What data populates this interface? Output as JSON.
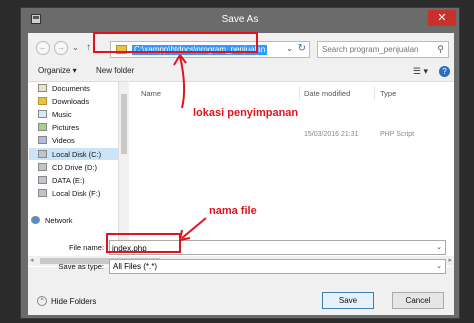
{
  "window": {
    "title": "Save As",
    "close_label": "✕"
  },
  "navigation": {
    "back": "←",
    "forward": "→",
    "recent": "⌄",
    "up": "↑",
    "address": "C:\\xampp\\htdocs\\program_penjualan",
    "address_dropdown": "⌄",
    "refresh": "↻",
    "search_placeholder": "Search program_penjualan",
    "search_icon": "⚲"
  },
  "toolbar": {
    "organize_label": "Organize ▾",
    "new_folder_label": "New folder",
    "view_icon": "☰ ▾",
    "help_icon": "?"
  },
  "sidebar": {
    "items": [
      {
        "label": "Documents",
        "icon": "documents-icon"
      },
      {
        "label": "Downloads",
        "icon": "downloads-icon"
      },
      {
        "label": "Music",
        "icon": "music-icon"
      },
      {
        "label": "Pictures",
        "icon": "pictures-icon"
      },
      {
        "label": "Videos",
        "icon": "videos-icon"
      },
      {
        "label": "Local Disk (C:)",
        "icon": "disk-icon",
        "selected": true
      },
      {
        "label": "CD Drive (D:)",
        "icon": "cd-drive-icon"
      },
      {
        "label": "DATA (E:)",
        "icon": "disk-icon"
      },
      {
        "label": "Local Disk (F:)",
        "icon": "disk-icon"
      },
      {
        "label": "Network",
        "icon": "network-icon"
      }
    ]
  },
  "file_list": {
    "columns": [
      "Name",
      "Date modified",
      "Type"
    ],
    "rows": [
      {
        "name": "",
        "date": "15/03/2016 21:31",
        "type": "PHP Script"
      }
    ]
  },
  "form": {
    "filename_label": "File name:",
    "filename_value": "index.php",
    "savetype_label": "Save as type:",
    "savetype_value": "All Files (*.*)",
    "dropdown_arrow": "⌄"
  },
  "footer": {
    "hide_folders_label": "Hide Folders",
    "hide_folders_icon": "^",
    "save_label": "Save",
    "cancel_label": "Cancel"
  },
  "annotations": {
    "location_text": "lokasi penyimpanan",
    "filename_text": "nama file",
    "color": "#e0141e"
  }
}
